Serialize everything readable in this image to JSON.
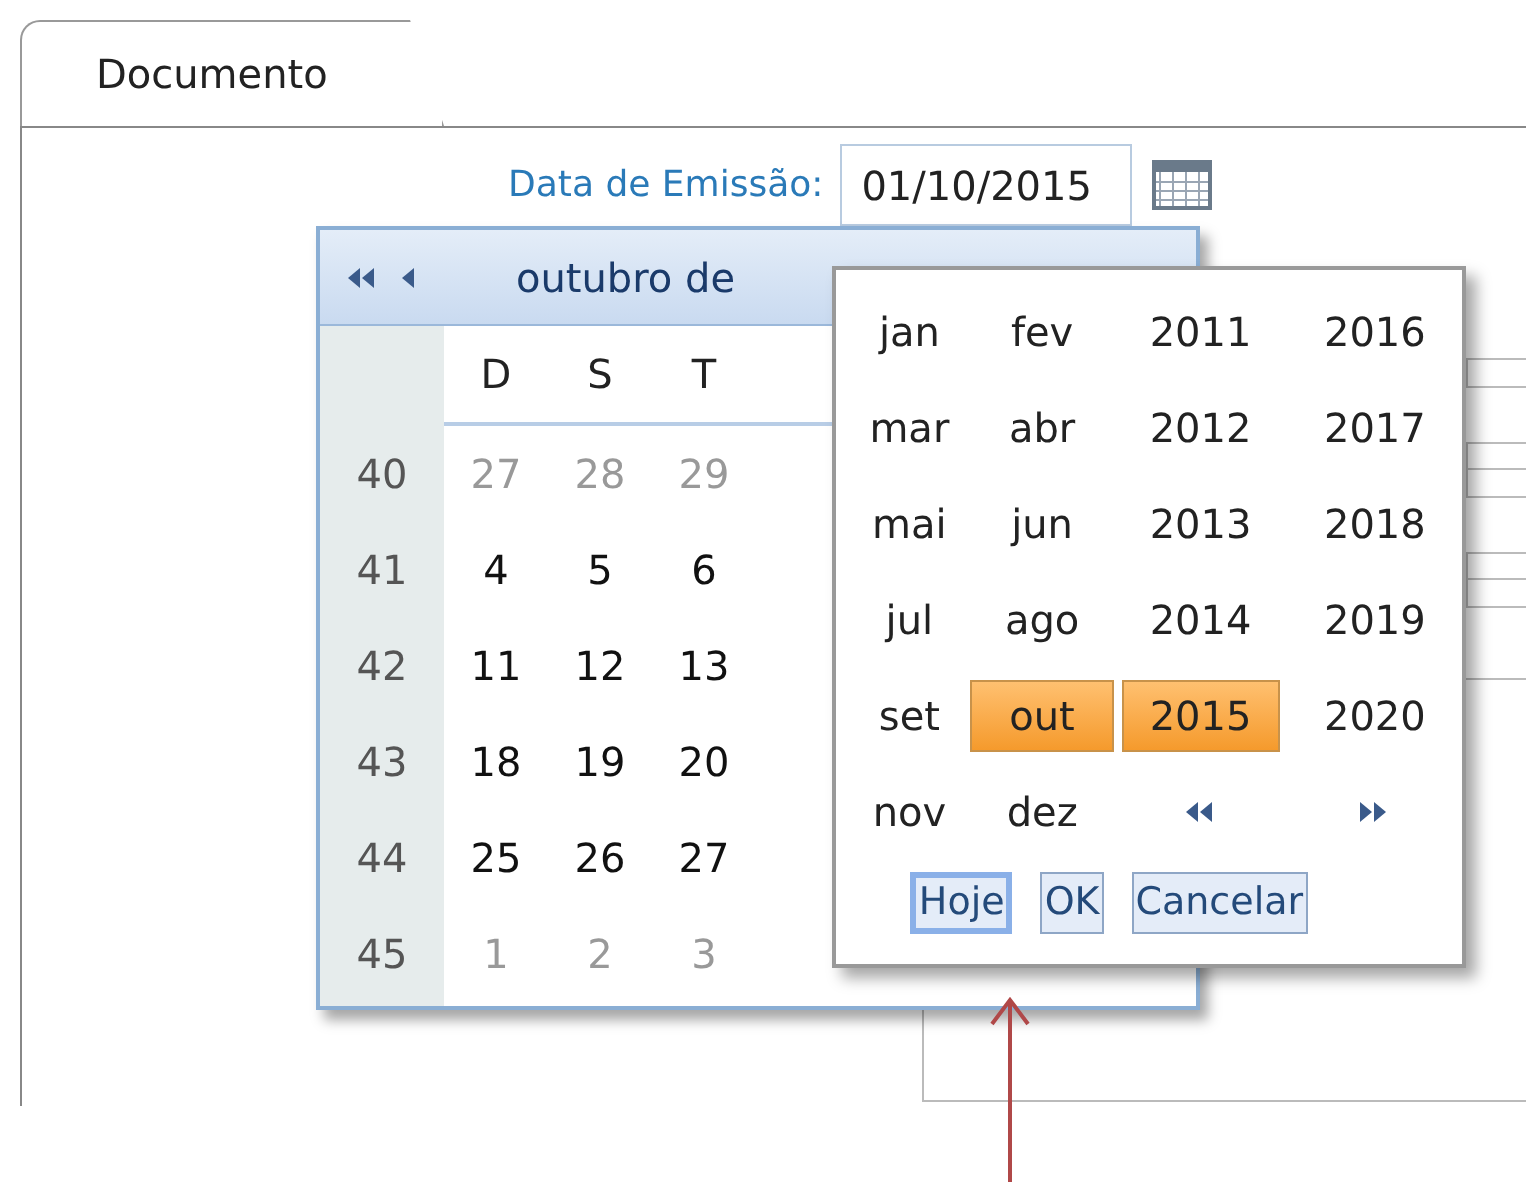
{
  "tabs": [
    {
      "label": "Documento",
      "selected": true
    }
  ],
  "issue_date": {
    "label": "Data de Emissão:",
    "value": "01/10/2015"
  },
  "calendar": {
    "title": "outubro de",
    "weekdays": [
      "D",
      "S",
      "T"
    ],
    "weeks": [
      {
        "number": "40",
        "days": [
          {
            "day": "27",
            "other_month": true
          },
          {
            "day": "28",
            "other_month": true
          },
          {
            "day": "29",
            "other_month": true
          }
        ]
      },
      {
        "number": "41",
        "days": [
          {
            "day": "4",
            "other_month": false
          },
          {
            "day": "5",
            "other_month": false
          },
          {
            "day": "6",
            "other_month": false
          }
        ]
      },
      {
        "number": "42",
        "days": [
          {
            "day": "11",
            "other_month": false
          },
          {
            "day": "12",
            "other_month": false
          },
          {
            "day": "13",
            "other_month": false
          }
        ]
      },
      {
        "number": "43",
        "days": [
          {
            "day": "18",
            "other_month": false
          },
          {
            "day": "19",
            "other_month": false
          },
          {
            "day": "20",
            "other_month": false
          }
        ]
      },
      {
        "number": "44",
        "days": [
          {
            "day": "25",
            "other_month": false
          },
          {
            "day": "26",
            "other_month": false
          },
          {
            "day": "27",
            "other_month": false
          }
        ]
      },
      {
        "number": "45",
        "days": [
          {
            "day": "1",
            "other_month": true
          },
          {
            "day": "2",
            "other_month": true
          },
          {
            "day": "3",
            "other_month": true
          }
        ]
      }
    ]
  },
  "month_picker": {
    "months": [
      {
        "label": "jan",
        "selected": false
      },
      {
        "label": "fev",
        "selected": false
      },
      {
        "label": "mar",
        "selected": false
      },
      {
        "label": "abr",
        "selected": false
      },
      {
        "label": "mai",
        "selected": false
      },
      {
        "label": "jun",
        "selected": false
      },
      {
        "label": "jul",
        "selected": false
      },
      {
        "label": "ago",
        "selected": false
      },
      {
        "label": "set",
        "selected": false
      },
      {
        "label": "out",
        "selected": true
      },
      {
        "label": "nov",
        "selected": false
      },
      {
        "label": "dez",
        "selected": false
      }
    ],
    "years": [
      {
        "label": "2011",
        "selected": false
      },
      {
        "label": "2012",
        "selected": false
      },
      {
        "label": "2013",
        "selected": false
      },
      {
        "label": "2014",
        "selected": false
      },
      {
        "label": "2015",
        "selected": true
      },
      {
        "label": "2016",
        "selected": false
      },
      {
        "label": "2017",
        "selected": false
      },
      {
        "label": "2018",
        "selected": false
      },
      {
        "label": "2019",
        "selected": false
      },
      {
        "label": "2020",
        "selected": false
      }
    ],
    "buttons": [
      {
        "label": "Hoje",
        "focused": true
      },
      {
        "label": "OK",
        "focused": false
      },
      {
        "label": "Cancelar",
        "focused": false
      }
    ]
  }
}
